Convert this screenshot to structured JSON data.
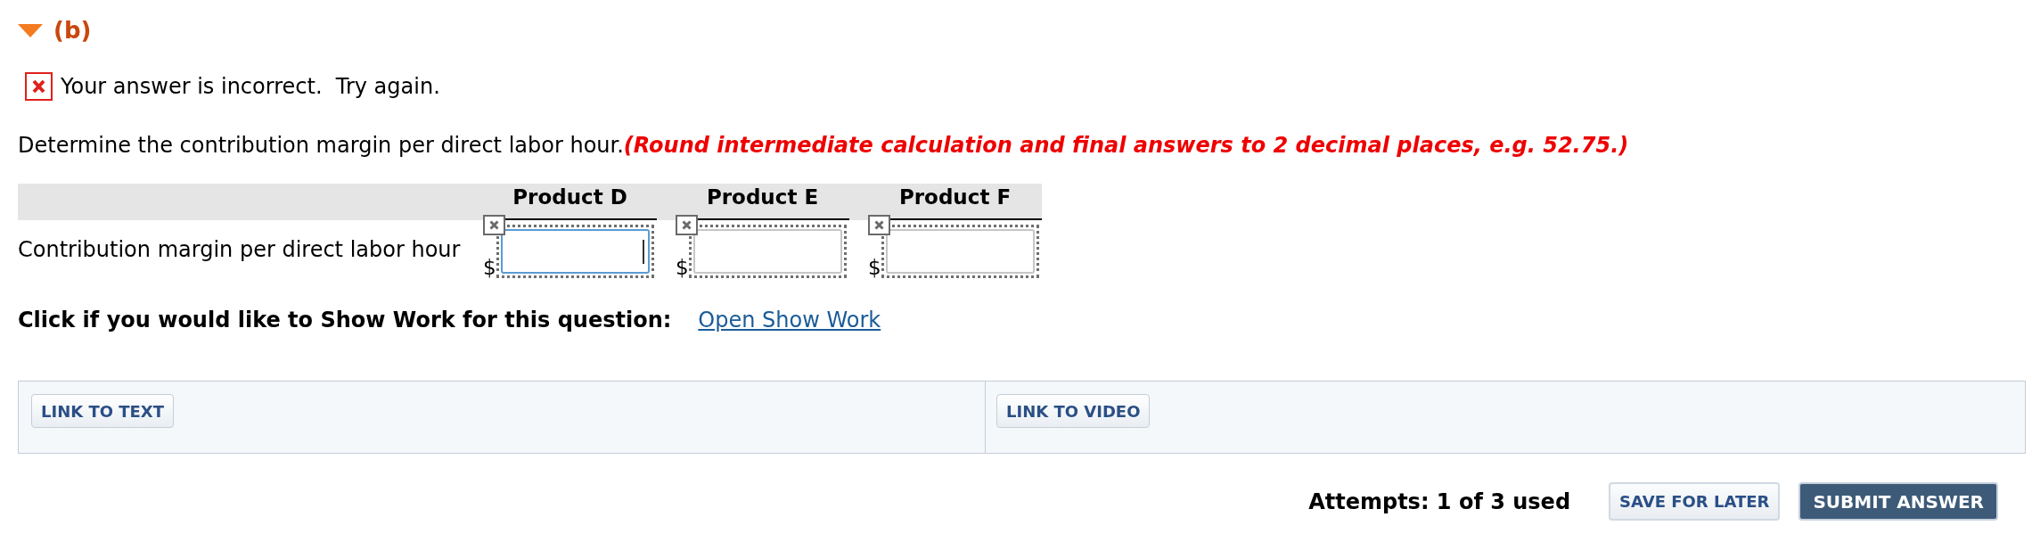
{
  "section": {
    "label": "(b)",
    "expanded": true
  },
  "feedback": {
    "correct": false,
    "message": "Your answer is incorrect.  Try again."
  },
  "question": {
    "prompt": "Determine the contribution margin per direct labor hour.",
    "instruction": "(Round intermediate calculation and final answers to 2 decimal places, e.g. 52.75.)"
  },
  "answer_table": {
    "columns": [
      "Product D",
      "Product E",
      "Product F"
    ],
    "rows": [
      {
        "label": "Contribution margin per direct labor hour",
        "cells": [
          {
            "prefix": "$",
            "incorrect": true,
            "focused": true
          },
          {
            "prefix": "$",
            "incorrect": true,
            "focused": false
          },
          {
            "prefix": "$",
            "incorrect": true,
            "focused": false
          }
        ]
      }
    ]
  },
  "show_work": {
    "prompt": "Click if you would like to Show Work for this question:",
    "link": "Open Show Work"
  },
  "resources": [
    "LINK TO TEXT",
    "LINK TO VIDEO"
  ],
  "footer": {
    "attempts": "Attempts: 1 of 3 used",
    "buttons": [
      {
        "label": "SAVE FOR LATER",
        "kind": "secondary"
      },
      {
        "label": "SUBMIT ANSWER",
        "kind": "primary"
      }
    ]
  }
}
